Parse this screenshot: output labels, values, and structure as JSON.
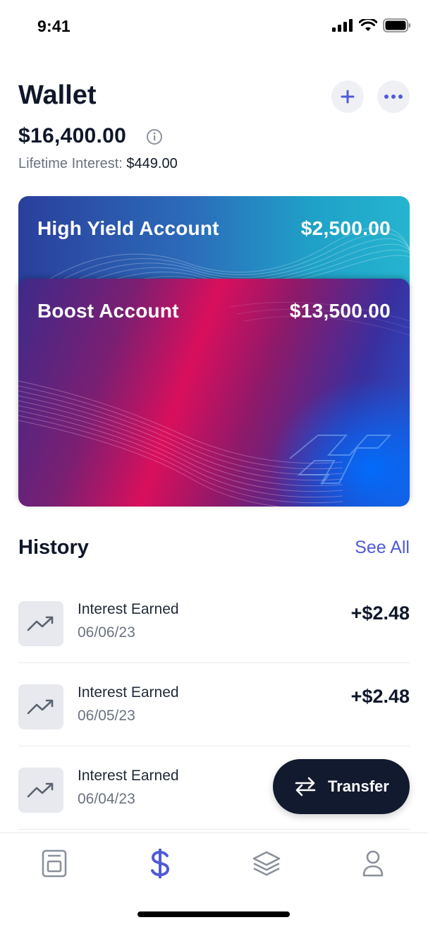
{
  "status_bar": {
    "time": "9:41"
  },
  "header": {
    "title": "Wallet",
    "balance": "$16,400.00",
    "lifetime_label": "Lifetime Interest:",
    "lifetime_value": "$449.00"
  },
  "cards": [
    {
      "name": "High Yield Account",
      "amount": "$2,500.00"
    },
    {
      "name": "Boost Account",
      "amount": "$13,500.00"
    }
  ],
  "history": {
    "title": "History",
    "see_all": "See All",
    "items": [
      {
        "title": "Interest Earned",
        "date": "06/06/23",
        "amount": "+$2.48"
      },
      {
        "title": "Interest Earned",
        "date": "06/05/23",
        "amount": "+$2.48"
      },
      {
        "title": "Interest Earned",
        "date": "06/04/23",
        "amount": ""
      }
    ]
  },
  "fab": {
    "label": "Transfer"
  },
  "tabbar": {
    "items": [
      {
        "icon": "home-icon",
        "active": false
      },
      {
        "icon": "dollar-icon",
        "active": true
      },
      {
        "icon": "layers-icon",
        "active": false
      },
      {
        "icon": "profile-icon",
        "active": false
      }
    ]
  },
  "colors": {
    "accent": "#4f5bd5",
    "dark": "#111a2e",
    "muted": "#6b7280"
  }
}
